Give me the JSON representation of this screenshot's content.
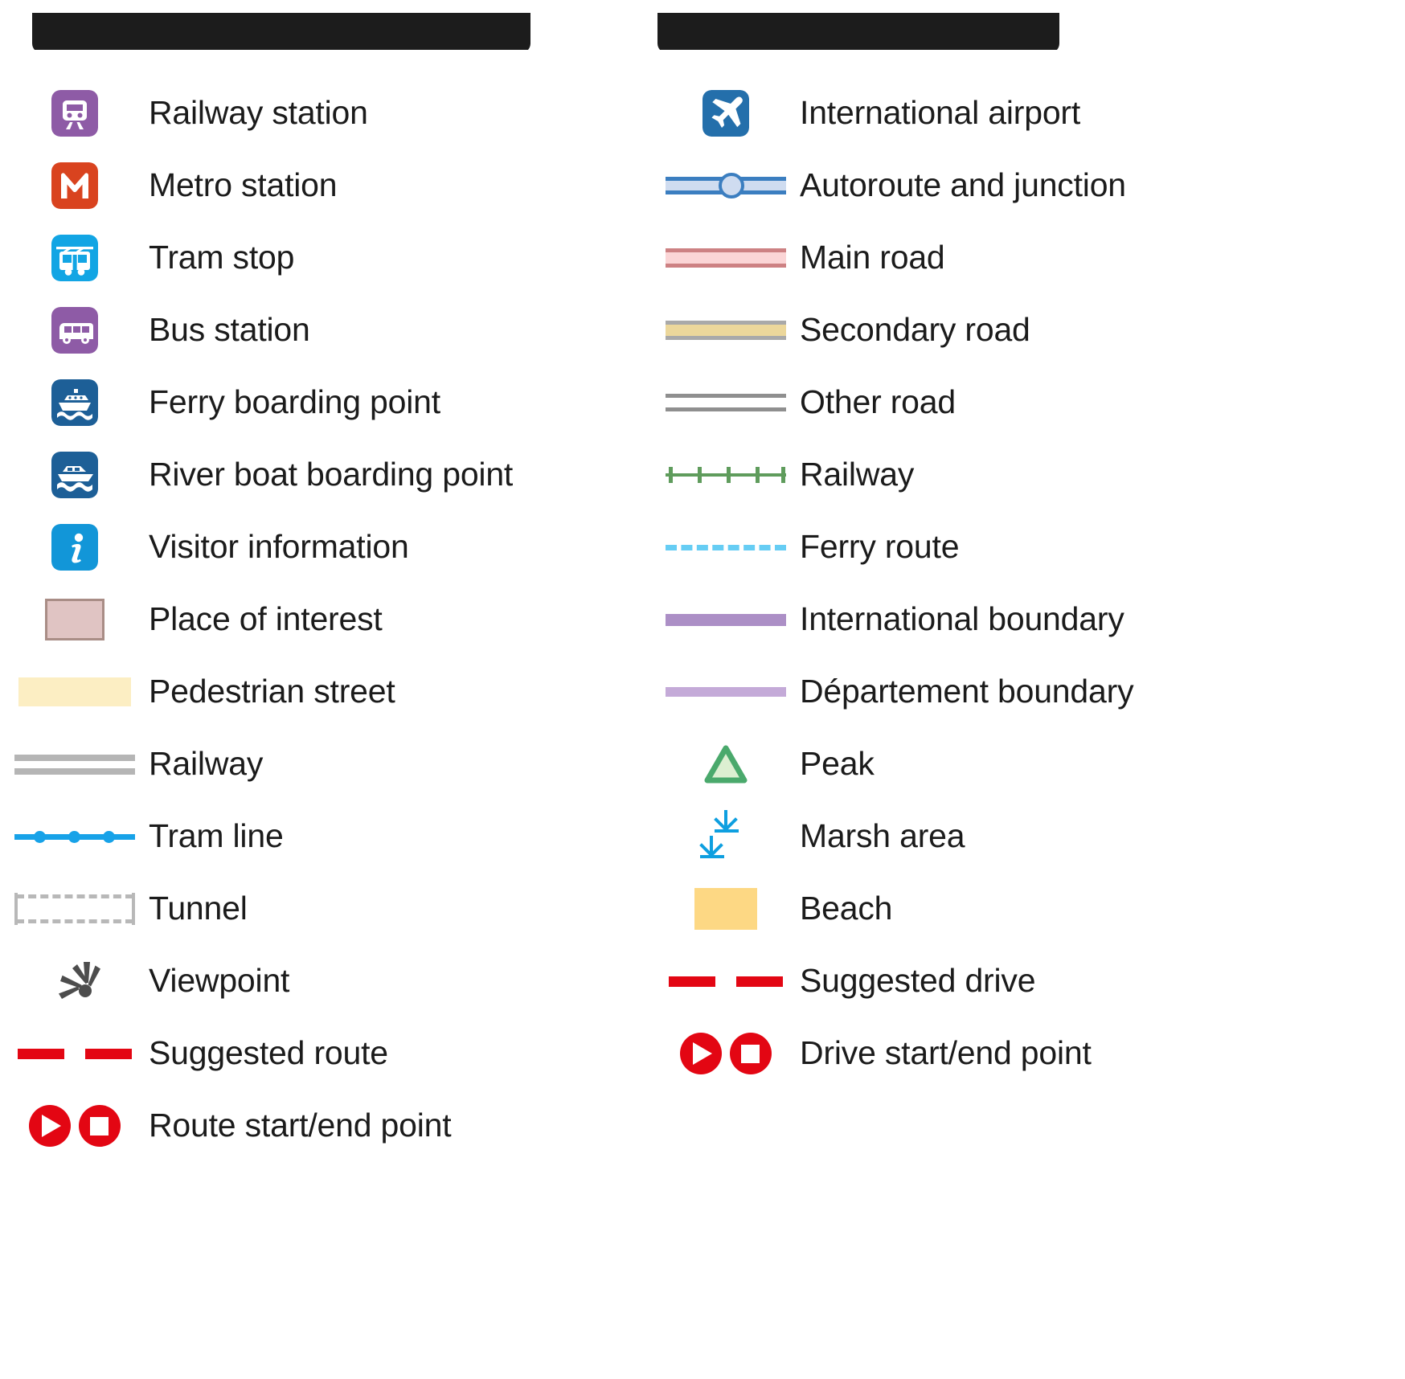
{
  "document": {
    "type": "map-legend",
    "title_left_redacted": true,
    "title_right_redacted": true
  },
  "palette": {
    "railway_station_bg": "#8e5ba6",
    "metro_bg": "#d9431f",
    "tram_bg": "#12a5e4",
    "bus_bg": "#8e5ba6",
    "ferry_bg": "#1d5f97",
    "riverboat_bg": "#1d5f97",
    "information_bg": "#1296d8",
    "airport_bg": "#246fab",
    "place_of_interest_fill": "#e0c4c3",
    "place_of_interest_border": "#a98d86",
    "pedestrian_street": "#fceec3",
    "railway_grey": "#b5b5b5",
    "tram_line": "#17a2e8",
    "tunnel_grey": "#b8b8b8",
    "viewpoint_grey": "#4d4d4d",
    "suggested_route_red": "#e30613",
    "autoroute_fill": "#cfdcf0",
    "autoroute_casing": "#3b7ec0",
    "main_road_fill": "#fbd5d6",
    "main_road_casing": "#cd8183",
    "secondary_road_fill": "#ecd79b",
    "secondary_road_casing": "#a9a9a9",
    "other_road_casing": "#8f8f8f",
    "railway_green": "#5f9c5c",
    "ferry_route_blue": "#66cdf4",
    "international_boundary": "#ac8fc6",
    "departement_boundary": "#c4aad8",
    "peak_green": "#4aa96c",
    "peak_fill": "#dcefd1",
    "marsh_blue": "#0e9fe0",
    "beach_yellow": "#fdd884"
  },
  "left_column": {
    "items": [
      {
        "icon": "railway-station-icon",
        "label": "Railway station"
      },
      {
        "icon": "metro-station-icon",
        "label": "Metro station"
      },
      {
        "icon": "tram-stop-icon",
        "label": "Tram stop"
      },
      {
        "icon": "bus-station-icon",
        "label": "Bus station"
      },
      {
        "icon": "ferry-boarding-point-icon",
        "label": "Ferry boarding point"
      },
      {
        "icon": "river-boat-boarding-point-icon",
        "label": "River boat boarding point"
      },
      {
        "icon": "visitor-information-icon",
        "label": "Visitor information"
      },
      {
        "icon": "place-of-interest-swatch",
        "label": "Place of interest"
      },
      {
        "icon": "pedestrian-street-swatch",
        "label": "Pedestrian street"
      },
      {
        "icon": "railway-line-symbol",
        "label": "Railway"
      },
      {
        "icon": "tram-line-symbol",
        "label": "Tram line"
      },
      {
        "icon": "tunnel-symbol",
        "label": "Tunnel"
      },
      {
        "icon": "viewpoint-icon",
        "label": "Viewpoint"
      },
      {
        "icon": "suggested-route-symbol",
        "label": "Suggested route"
      },
      {
        "icon": "route-start-end-point-symbol",
        "label": "Route start/end point"
      }
    ]
  },
  "right_column": {
    "items": [
      {
        "icon": "international-airport-icon",
        "label": "International airport"
      },
      {
        "icon": "autoroute-junction-symbol",
        "label": "Autoroute and junction"
      },
      {
        "icon": "main-road-symbol",
        "label": "Main road"
      },
      {
        "icon": "secondary-road-symbol",
        "label": "Secondary road"
      },
      {
        "icon": "other-road-symbol",
        "label": "Other road"
      },
      {
        "icon": "railway-symbol",
        "label": "Railway"
      },
      {
        "icon": "ferry-route-symbol",
        "label": "Ferry route"
      },
      {
        "icon": "international-boundary-symbol",
        "label": "International boundary"
      },
      {
        "icon": "departement-boundary-symbol",
        "label": "Département boundary"
      },
      {
        "icon": "peak-icon",
        "label": "Peak"
      },
      {
        "icon": "marsh-area-icon",
        "label": "Marsh area"
      },
      {
        "icon": "beach-swatch",
        "label": "Beach"
      },
      {
        "icon": "suggested-drive-symbol",
        "label": "Suggested drive"
      },
      {
        "icon": "drive-start-end-point-symbol",
        "label": "Drive start/end point"
      }
    ]
  }
}
